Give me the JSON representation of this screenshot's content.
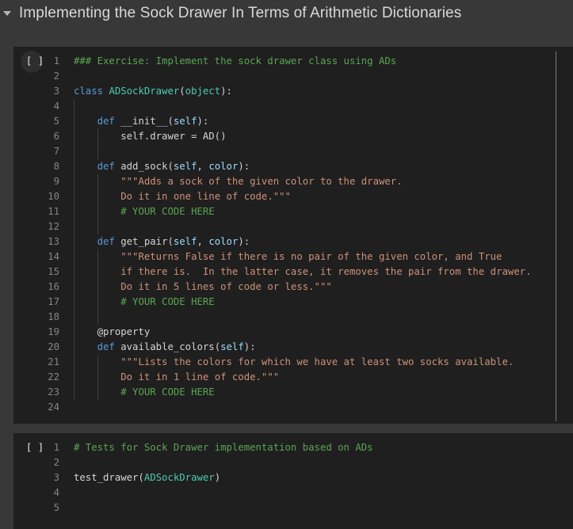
{
  "header": {
    "title": "Implementing the Sock Drawer In Terms of Arithmetic Dictionaries",
    "collapse_icon": "triangle-down"
  },
  "colors": {
    "page_bg": "#383838",
    "cell_bg": "#1f1f1f",
    "keyword": "#569cd6",
    "type": "#4ec9b0",
    "string": "#ce9178",
    "comment": "#5aa552",
    "param": "#9cdcfe",
    "plain": "#d4d4d4",
    "line_number": "#858585"
  },
  "cells": [
    {
      "run_label": "[ ]",
      "run_halo": true,
      "scrollbar": true,
      "lines": [
        {
          "n": "1",
          "g": 0,
          "segs": [
            {
              "c": "comment",
              "t": "### Exercise: Implement the sock drawer class using ADs"
            }
          ]
        },
        {
          "n": "2",
          "g": 0,
          "segs": []
        },
        {
          "n": "3",
          "g": 0,
          "segs": [
            {
              "c": "keyword",
              "t": "class"
            },
            {
              "c": "plain",
              "t": " "
            },
            {
              "c": "type",
              "t": "ADSockDrawer"
            },
            {
              "c": "plain",
              "t": "("
            },
            {
              "c": "type",
              "t": "object"
            },
            {
              "c": "plain",
              "t": "):"
            }
          ]
        },
        {
          "n": "4",
          "g": 1,
          "segs": []
        },
        {
          "n": "5",
          "g": 1,
          "segs": [
            {
              "c": "plain",
              "t": "    "
            },
            {
              "c": "keyword",
              "t": "def"
            },
            {
              "c": "plain",
              "t": " __init__("
            },
            {
              "c": "param",
              "t": "self"
            },
            {
              "c": "plain",
              "t": "):"
            }
          ]
        },
        {
          "n": "6",
          "g": 2,
          "segs": [
            {
              "c": "plain",
              "t": "        self.drawer = AD()"
            }
          ]
        },
        {
          "n": "7",
          "g": 2,
          "segs": []
        },
        {
          "n": "8",
          "g": 1,
          "segs": [
            {
              "c": "plain",
              "t": "    "
            },
            {
              "c": "keyword",
              "t": "def"
            },
            {
              "c": "plain",
              "t": " add_sock("
            },
            {
              "c": "param",
              "t": "self"
            },
            {
              "c": "plain",
              "t": ", "
            },
            {
              "c": "param",
              "t": "color"
            },
            {
              "c": "plain",
              "t": "):"
            }
          ]
        },
        {
          "n": "9",
          "g": 2,
          "segs": [
            {
              "c": "plain",
              "t": "        "
            },
            {
              "c": "string",
              "t": "\"\"\"Adds a sock of the given color to the drawer."
            }
          ]
        },
        {
          "n": "10",
          "g": 2,
          "segs": [
            {
              "c": "plain",
              "t": "        "
            },
            {
              "c": "string",
              "t": "Do it in one line of code.\"\"\""
            }
          ]
        },
        {
          "n": "11",
          "g": 2,
          "segs": [
            {
              "c": "plain",
              "t": "        "
            },
            {
              "c": "comment",
              "t": "# YOUR CODE HERE"
            }
          ]
        },
        {
          "n": "12",
          "g": 2,
          "segs": []
        },
        {
          "n": "13",
          "g": 1,
          "segs": [
            {
              "c": "plain",
              "t": "    "
            },
            {
              "c": "keyword",
              "t": "def"
            },
            {
              "c": "plain",
              "t": " get_pair("
            },
            {
              "c": "param",
              "t": "self"
            },
            {
              "c": "plain",
              "t": ", "
            },
            {
              "c": "param",
              "t": "color"
            },
            {
              "c": "plain",
              "t": "):"
            }
          ]
        },
        {
          "n": "14",
          "g": 2,
          "segs": [
            {
              "c": "plain",
              "t": "        "
            },
            {
              "c": "string",
              "t": "\"\"\"Returns False if there is no pair of the given color, and True"
            }
          ]
        },
        {
          "n": "15",
          "g": 2,
          "segs": [
            {
              "c": "plain",
              "t": "        "
            },
            {
              "c": "string",
              "t": "if there is.  In the latter case, it removes the pair from the drawer."
            }
          ]
        },
        {
          "n": "16",
          "g": 2,
          "segs": [
            {
              "c": "plain",
              "t": "        "
            },
            {
              "c": "string",
              "t": "Do it in 5 lines of code or less.\"\"\""
            }
          ]
        },
        {
          "n": "17",
          "g": 2,
          "segs": [
            {
              "c": "plain",
              "t": "        "
            },
            {
              "c": "comment",
              "t": "# YOUR CODE HERE"
            }
          ]
        },
        {
          "n": "18",
          "g": 2,
          "segs": []
        },
        {
          "n": "19",
          "g": 1,
          "segs": [
            {
              "c": "plain",
              "t": "    @property"
            }
          ]
        },
        {
          "n": "20",
          "g": 1,
          "segs": [
            {
              "c": "plain",
              "t": "    "
            },
            {
              "c": "keyword",
              "t": "def"
            },
            {
              "c": "plain",
              "t": " available_colors("
            },
            {
              "c": "param",
              "t": "self"
            },
            {
              "c": "plain",
              "t": "):"
            }
          ]
        },
        {
          "n": "21",
          "g": 2,
          "segs": [
            {
              "c": "plain",
              "t": "        "
            },
            {
              "c": "string",
              "t": "\"\"\"Lists the colors for which we have at least two socks available."
            }
          ]
        },
        {
          "n": "22",
          "g": 2,
          "segs": [
            {
              "c": "plain",
              "t": "        "
            },
            {
              "c": "string",
              "t": "Do it in 1 line of code.\"\"\""
            }
          ]
        },
        {
          "n": "23",
          "g": 2,
          "segs": [
            {
              "c": "plain",
              "t": "        "
            },
            {
              "c": "comment",
              "t": "# YOUR CODE HERE"
            }
          ]
        },
        {
          "n": "24",
          "g": 0,
          "segs": []
        }
      ]
    },
    {
      "run_label": "[ ]",
      "run_halo": false,
      "scrollbar": false,
      "lines": [
        {
          "n": "1",
          "g": 0,
          "segs": [
            {
              "c": "comment",
              "t": "# Tests for Sock Drawer implementation based on ADs"
            }
          ]
        },
        {
          "n": "2",
          "g": 0,
          "segs": []
        },
        {
          "n": "3",
          "g": 0,
          "segs": [
            {
              "c": "plain",
              "t": "test_drawer("
            },
            {
              "c": "type",
              "t": "ADSockDrawer"
            },
            {
              "c": "plain",
              "t": ")"
            }
          ]
        },
        {
          "n": "4",
          "g": 0,
          "segs": []
        },
        {
          "n": "5",
          "g": 0,
          "segs": []
        }
      ]
    }
  ]
}
